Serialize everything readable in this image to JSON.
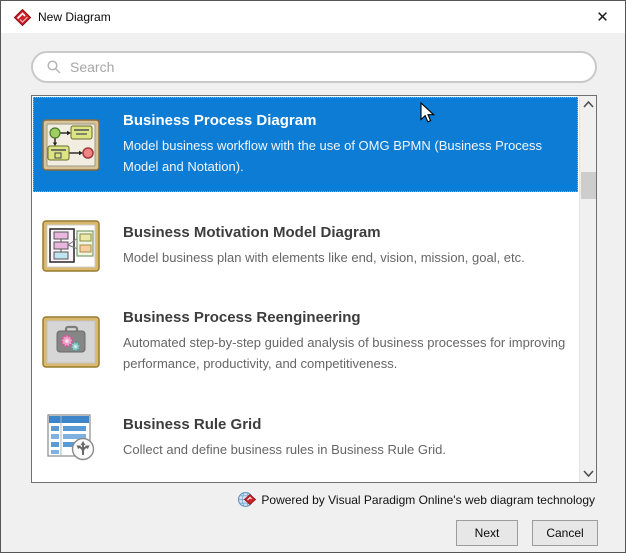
{
  "window": {
    "title": "New Diagram"
  },
  "search": {
    "placeholder": "Search"
  },
  "list": {
    "items": [
      {
        "title": "Business Process Diagram",
        "description": "Model business workflow with the use of OMG BPMN (Business Process Model and Notation).",
        "selected": true,
        "icon": "bpmn-diagram-icon"
      },
      {
        "title": "Business Motivation Model Diagram",
        "description": "Model business plan with elements like end, vision, mission, goal, etc.",
        "selected": false,
        "icon": "business-motivation-icon"
      },
      {
        "title": "Business Process Reengineering",
        "description": "Automated step-by-step guided analysis of business processes for improving performance, productivity, and competitiveness.",
        "selected": false,
        "icon": "business-process-reengineering-icon"
      },
      {
        "title": "Business Rule Grid",
        "description": "Collect and define business rules in Business Rule Grid.",
        "selected": false,
        "icon": "business-rule-grid-icon"
      }
    ]
  },
  "footer": {
    "powered_by": "Powered by Visual Paradigm Online's web diagram technology"
  },
  "buttons": {
    "next": "Next",
    "cancel": "Cancel"
  },
  "colors": {
    "selection_blue": "#0c7cd5",
    "focus_dotted_orange": "#e8944a",
    "brand_red": "#cc2229",
    "dialog_bg": "#f0f0f0"
  }
}
